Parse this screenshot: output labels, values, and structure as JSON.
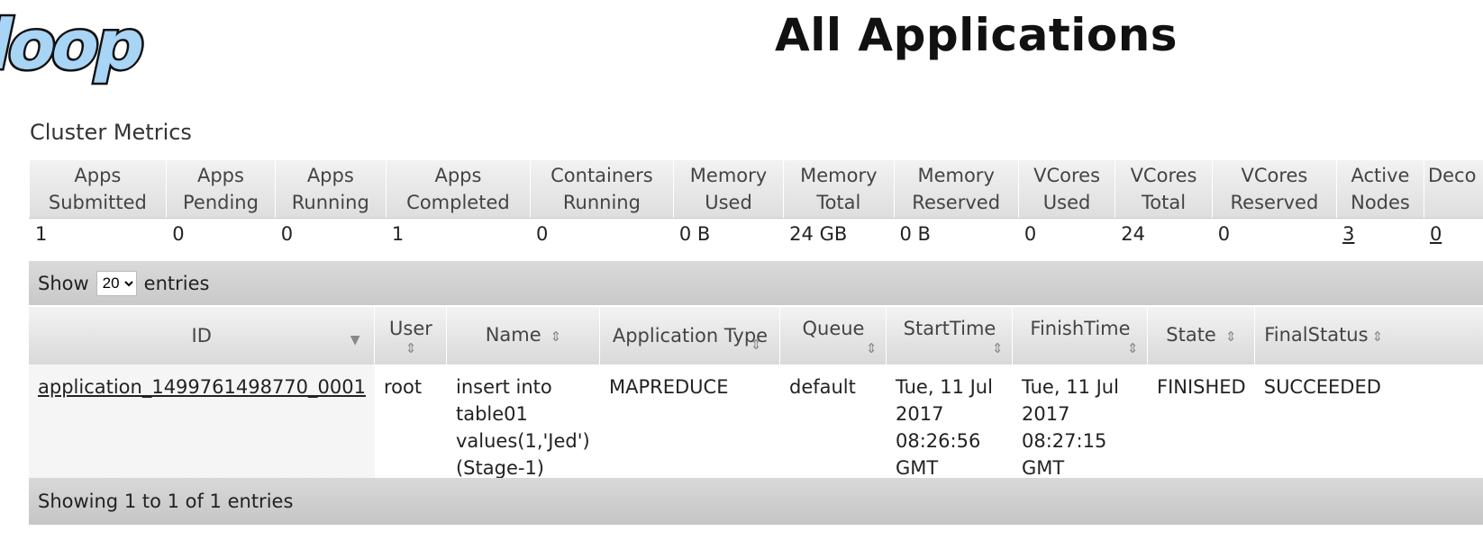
{
  "page": {
    "title": "All Applications",
    "logo_text": "loop"
  },
  "cluster_metrics": {
    "heading": "Cluster Metrics",
    "columns": [
      "Apps Submitted",
      "Apps Pending",
      "Apps Running",
      "Apps Completed",
      "Containers Running",
      "Memory Used",
      "Memory Total",
      "Memory Reserved",
      "VCores Used",
      "VCores Total",
      "VCores Reserved",
      "Active Nodes",
      "Deco"
    ],
    "values": [
      "1",
      "0",
      "0",
      "1",
      "0",
      "0 B",
      "24 GB",
      "0 B",
      "0",
      "24",
      "0",
      "3",
      "0"
    ]
  },
  "show_entries": {
    "prefix": "Show",
    "selected": "20",
    "suffix": "entries"
  },
  "applications": {
    "columns": [
      "ID",
      "User",
      "Name",
      "Application Type",
      "Queue",
      "StartTime",
      "FinishTime",
      "State",
      "FinalStatus"
    ],
    "rows": [
      {
        "id": "application_1499761498770_0001",
        "user": "root",
        "name": "insert into table01 values(1,'Jed') (Stage-1)",
        "type": "MAPREDUCE",
        "queue": "default",
        "start": "Tue, 11 Jul 2017 08:26:56 GMT",
        "finish": "Tue, 11 Jul 2017 08:27:15 GMT",
        "state": "FINISHED",
        "final_status": "SUCCEEDED"
      }
    ]
  },
  "footer": {
    "info": "Showing 1 to 1 of 1 entries"
  },
  "colors": {
    "logo_fill": "#a8d4f5",
    "logo_stroke": "#111111"
  }
}
